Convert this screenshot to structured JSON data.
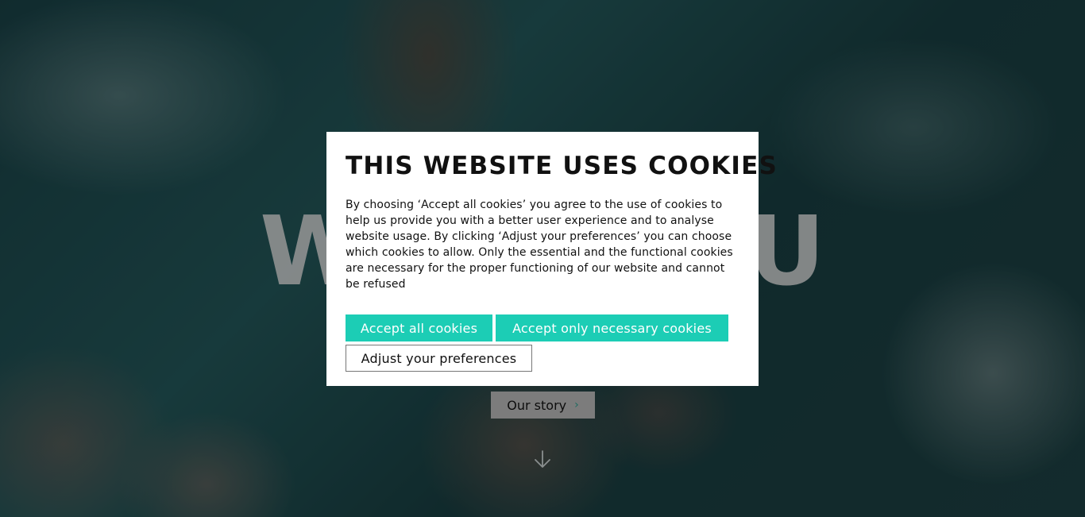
{
  "hero": {
    "heading_left": "W",
    "heading_right": "U",
    "story_button_label": "Our story",
    "story_button_chevron": "›",
    "scroll_icon": "arrow-down-icon"
  },
  "cookie_modal": {
    "title": "THIS WEBSITE USES COOKIES",
    "body": "By choosing ‘Accept all cookies’ you agree to the use of cookies to help us provide you with a better user experience and to analyse website usage. By clicking ‘Adjust your preferences’ you can choose which cookies to allow. Only the essential and the functional cookies are necessary for the proper functioning of our website and cannot be refused",
    "buttons": {
      "accept_all": "Accept all cookies",
      "accept_necessary": "Accept only necessary cookies",
      "adjust": "Adjust your preferences"
    }
  },
  "colors": {
    "accent": "#1ccdb5",
    "overlay": "#000000",
    "modal_background": "#ffffff"
  }
}
